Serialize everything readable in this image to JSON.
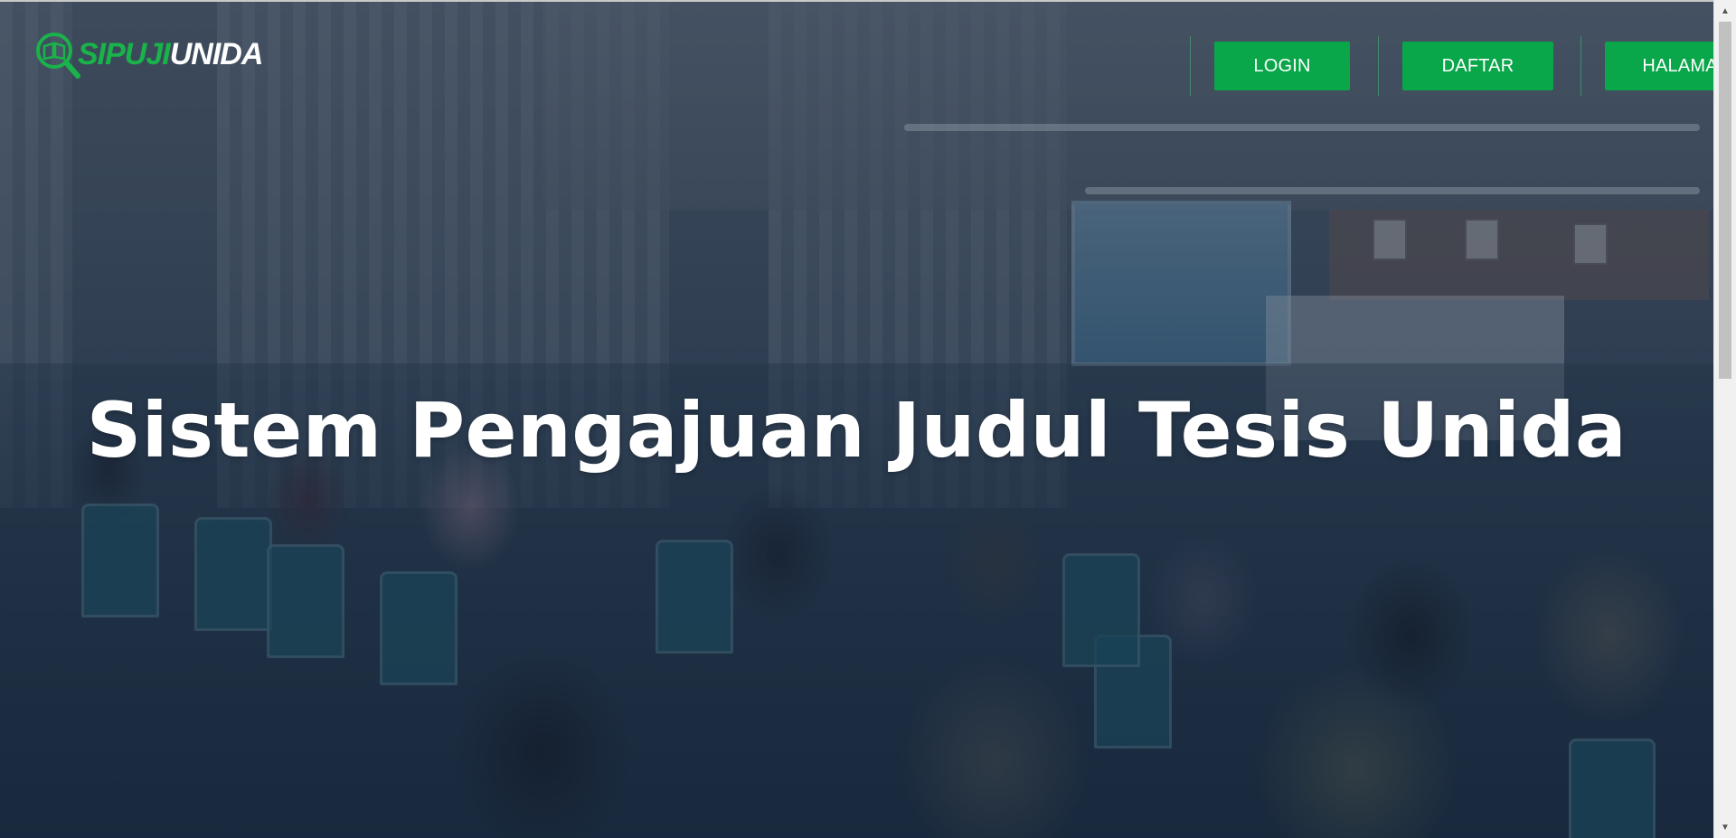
{
  "brand": {
    "logo_part_1": "SIPUJI",
    "logo_part_2": "UNIDA",
    "logo_icon": "magnifier-book-icon",
    "colors": {
      "green": "#19b34a",
      "white": "#ffffff"
    }
  },
  "nav": {
    "login_label": "LOGIN",
    "register_label": "DAFTAR",
    "home_label": "HALAMAN UTAMA",
    "button_color": "#0aa64a"
  },
  "hero": {
    "title": "Sistem Pengajuan Judul Tesis Unida",
    "overlay_color": "#16284080"
  },
  "scrollbar": {
    "up_icon": "scroll-up-arrow-icon",
    "down_icon": "scroll-down-arrow-icon"
  }
}
